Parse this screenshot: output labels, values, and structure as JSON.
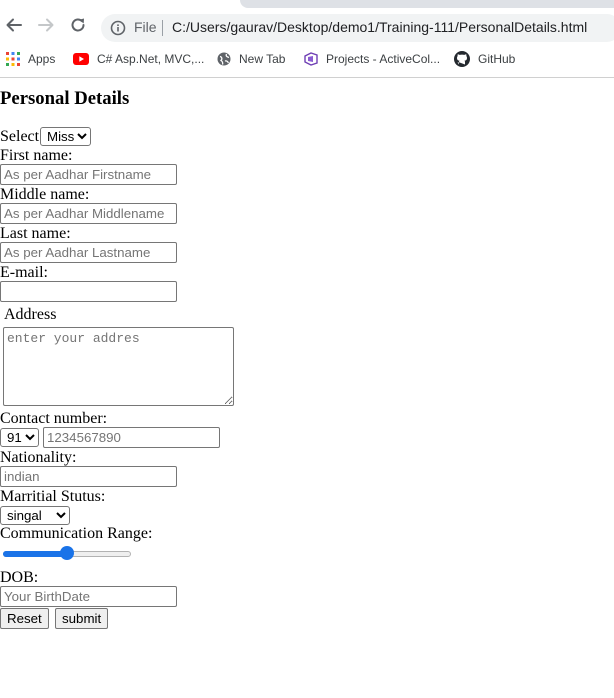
{
  "browser": {
    "file_label": "File",
    "url": "C:/Users/gaurav/Desktop/demo1/Training-111/PersonalDetails.html",
    "bookmarks": [
      {
        "label": "Apps",
        "icon": "apps-grid-icon"
      },
      {
        "label": "C# Asp.Net, MVC,...",
        "icon": "youtube-icon"
      },
      {
        "label": "New Tab",
        "icon": "globe-icon"
      },
      {
        "label": "Projects - ActiveCol...",
        "icon": "azure-devops-icon"
      },
      {
        "label": "GitHub",
        "icon": "github-icon"
      }
    ]
  },
  "form": {
    "heading": "Personal Details",
    "select_label": "Select",
    "title_value": "Miss",
    "first_name_label": "First name:",
    "first_name_placeholder": "As per Aadhar Firstname",
    "middle_name_label": "Middle name:",
    "middle_name_placeholder": "As per Aadhar Middlename",
    "last_name_label": "Last name:",
    "last_name_placeholder": "As per Aadhar Lastname",
    "email_label": "E-mail:",
    "email_value": "",
    "address_label": "Address",
    "address_placeholder": "enter your addres",
    "contact_label": "Contact number:",
    "country_code": "91",
    "phone_placeholder": "1234567890",
    "nationality_label": "Nationality:",
    "nationality_placeholder": "indian",
    "marital_label": "Marritial Stutus:",
    "marital_value": "singal",
    "range_label": "Communication Range:",
    "range_value_percent": 50,
    "dob_label": "DOB:",
    "dob_placeholder": "Your BirthDate",
    "reset_label": "Reset",
    "submit_label": "submit"
  },
  "colors": {
    "accent": "#1a73e8",
    "youtube": "#ff0000",
    "omnibox_bg": "#f1f3f4"
  }
}
